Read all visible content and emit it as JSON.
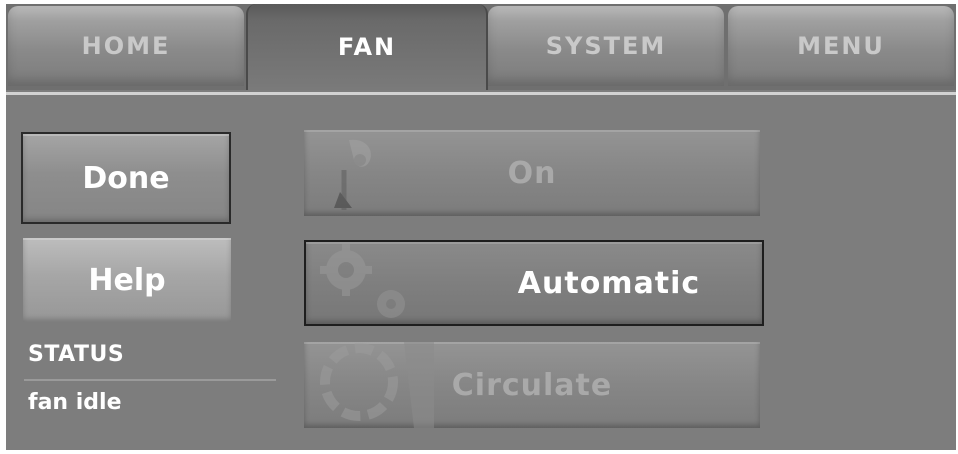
{
  "tabs": [
    {
      "label": "HOME",
      "active": false
    },
    {
      "label": "FAN",
      "active": true
    },
    {
      "label": "SYSTEM",
      "active": false
    },
    {
      "label": "MENU",
      "active": false
    }
  ],
  "side": {
    "done_label": "Done",
    "help_label": "Help"
  },
  "status": {
    "title": "STATUS",
    "value": "fan idle"
  },
  "fan_modes": [
    {
      "label": "On",
      "selected": false
    },
    {
      "label": "Automatic",
      "selected": true
    },
    {
      "label": "Circulate",
      "selected": false
    }
  ],
  "colors": {
    "screen_bg": "#7d7d7d",
    "selected_text": "#ffffff",
    "inactive_text": "#a9a9a9"
  },
  "icons": [
    "fan-icon",
    "gears-icon",
    "circulation-icon"
  ]
}
